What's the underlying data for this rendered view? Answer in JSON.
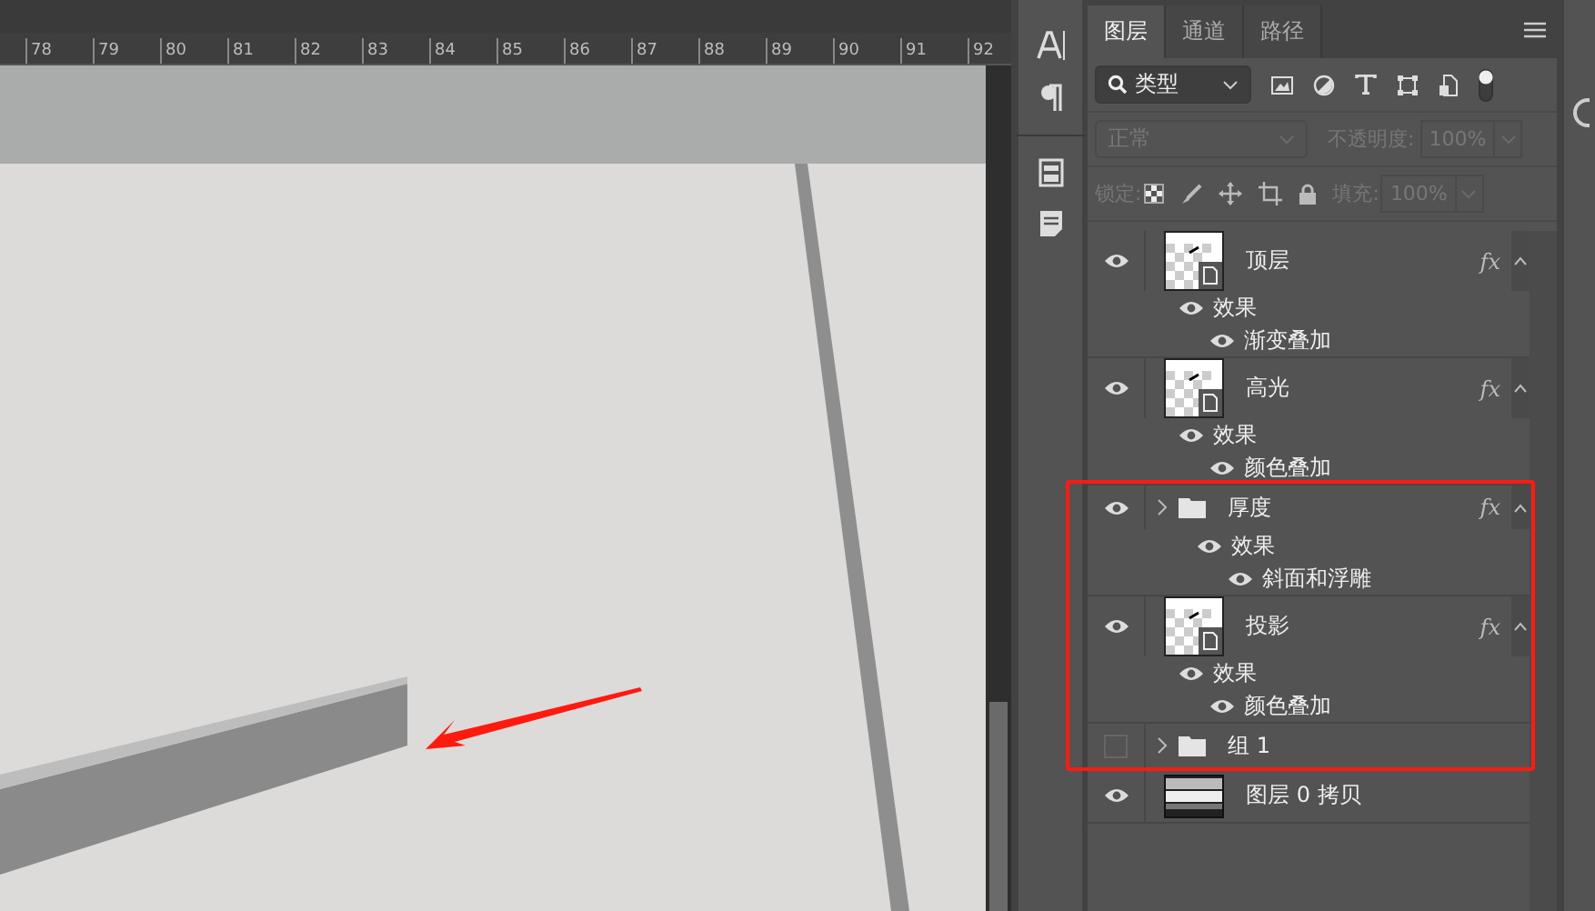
{
  "ruler": {
    "ticks": [
      "78",
      "79",
      "80",
      "81",
      "82",
      "83",
      "84",
      "85",
      "86",
      "87",
      "88",
      "89",
      "90",
      "91",
      "92"
    ]
  },
  "panel": {
    "tabs": [
      {
        "label": "图层",
        "selected": true
      },
      {
        "label": "通道",
        "selected": false
      },
      {
        "label": "路径",
        "selected": false
      }
    ],
    "filter": {
      "value": "类型"
    },
    "blend_mode": {
      "value": "正常",
      "disabled": true
    },
    "opacity": {
      "label": "不透明度:",
      "value": "100%",
      "disabled": true
    },
    "lock": {
      "label": "锁定:"
    },
    "fill": {
      "label": "填充:",
      "value": "100%",
      "disabled": true
    },
    "layers": [
      {
        "kind": "smart",
        "name": "顶层",
        "visible": true,
        "fx": "fx",
        "effects_label": "效果",
        "effects": [
          "渐变叠加"
        ]
      },
      {
        "kind": "smart",
        "name": "高光",
        "visible": true,
        "fx": "fx",
        "effects_label": "效果",
        "effects": [
          "颜色叠加"
        ]
      },
      {
        "kind": "group",
        "name": "厚度",
        "visible": true,
        "fx": "fx",
        "effects_label": "效果",
        "effects": [
          "斜面和浮雕"
        ]
      },
      {
        "kind": "smart",
        "name": "投影",
        "visible": true,
        "fx": "fx",
        "effects_label": "效果",
        "effects": [
          "颜色叠加"
        ]
      },
      {
        "kind": "group",
        "name": "组 1",
        "visible": false
      },
      {
        "kind": "image",
        "name": "图层 0 拷贝",
        "visible": true
      }
    ]
  }
}
